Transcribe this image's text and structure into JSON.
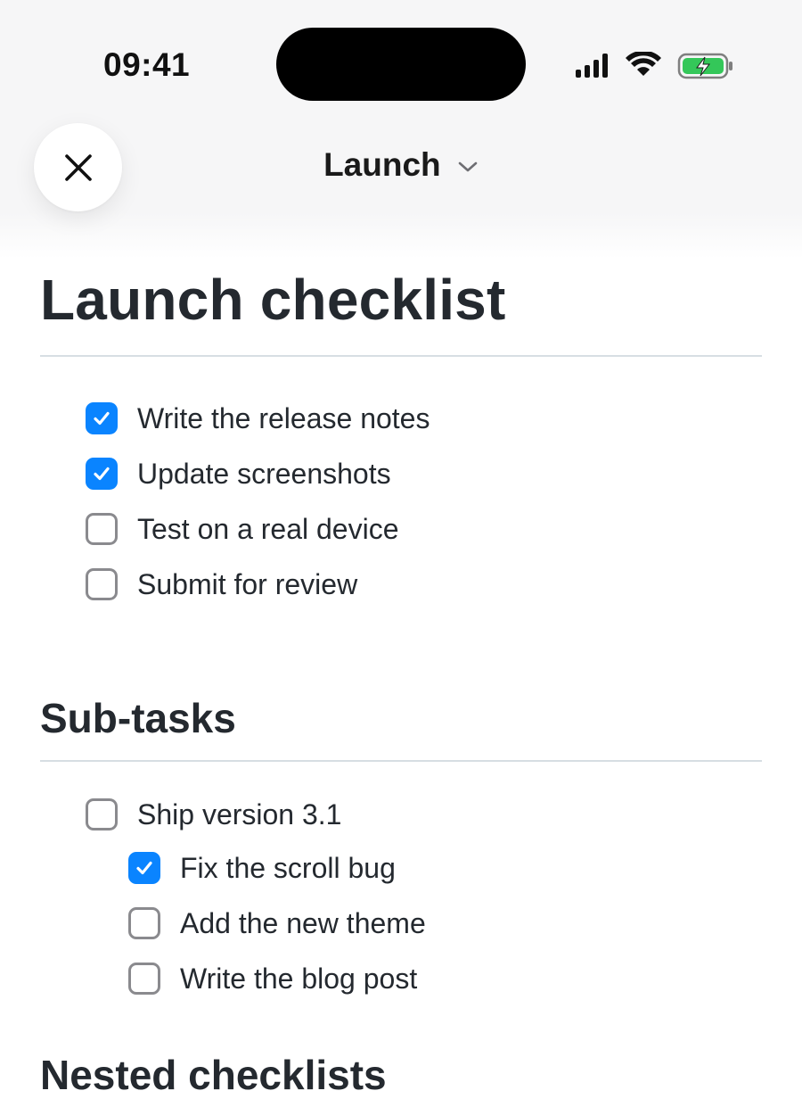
{
  "status_bar": {
    "time": "09:41",
    "icons": [
      "signal-icon",
      "wifi-icon",
      "battery-charging-icon"
    ],
    "battery_color": "#34c759"
  },
  "nav": {
    "title": "Launch",
    "close_icon": "close-icon",
    "dropdown_icon": "chevron-down-icon"
  },
  "page": {
    "title": "Launch checklist",
    "checklist": [
      {
        "label": "Write the release notes",
        "checked": true
      },
      {
        "label": "Update screenshots",
        "checked": true
      },
      {
        "label": "Test on a real device",
        "checked": false
      },
      {
        "label": "Submit for review",
        "checked": false
      }
    ],
    "subtasks_heading": "Sub-tasks",
    "subtasks": [
      {
        "label": "Ship version 3.1",
        "checked": false,
        "level": 0
      },
      {
        "label": "Fix the scroll bug",
        "checked": true,
        "level": 1
      },
      {
        "label": "Add the new theme",
        "checked": false,
        "level": 1
      },
      {
        "label": "Write the blog post",
        "checked": false,
        "level": 1
      }
    ],
    "next_heading": "Nested checklists"
  },
  "colors": {
    "accent": "#0a84ff",
    "unchecked_border": "#8a8a8e",
    "divider": "#d7dee3",
    "text": "#24292f"
  }
}
